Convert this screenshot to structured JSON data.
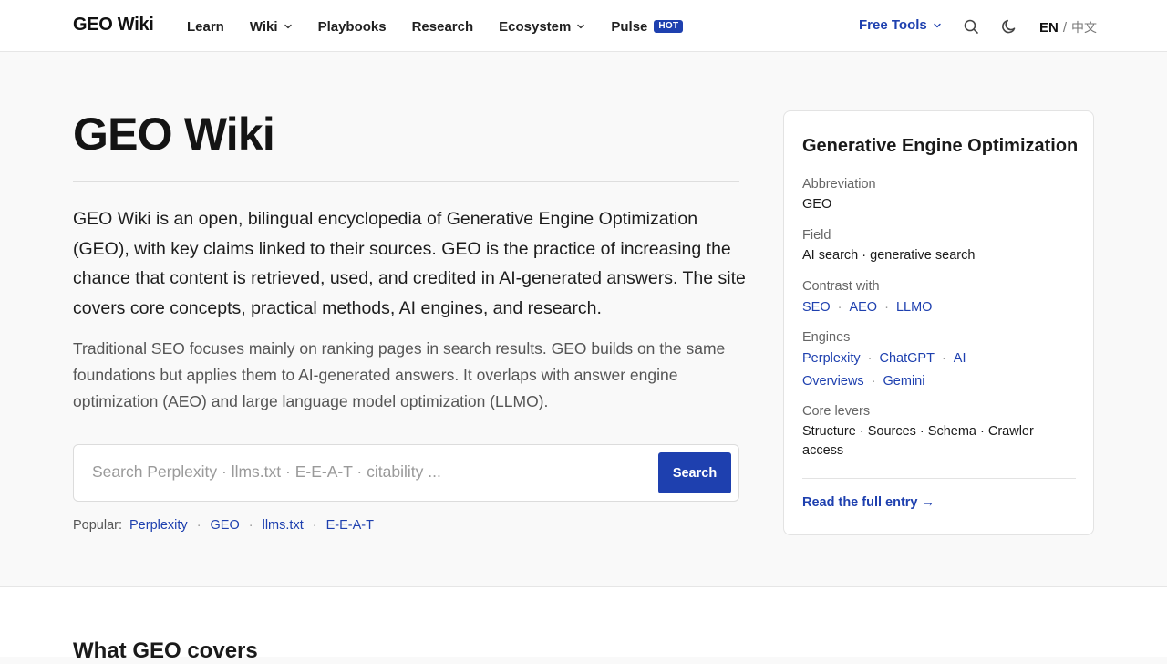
{
  "header": {
    "brand": "GEO Wiki",
    "nav": [
      {
        "label": "Learn"
      },
      {
        "label": "Wiki"
      },
      {
        "label": "Playbooks"
      },
      {
        "label": "Research"
      },
      {
        "label": "Ecosystem"
      },
      {
        "label": "Pulse",
        "badge": "HOT"
      }
    ],
    "free_tools": "Free Tools",
    "lang_en": "EN",
    "lang_sep": "/",
    "lang_zh": "中文"
  },
  "main": {
    "title": "GEO Wiki",
    "lead": "GEO Wiki is an open, bilingual encyclopedia of Generative Engine Optimization (GEO), with key claims linked to their sources. GEO is the practice of increasing the chance that content is retrieved, used, and credited in AI-generated answers. The site covers core concepts, practical methods, AI engines, and research.",
    "sub": "Traditional SEO focuses mainly on ranking pages in search results. GEO builds on the same foundations but applies them to AI-generated answers. It overlaps with answer engine optimization (AEO) and large language model optimization (LLMO).",
    "search": {
      "placeholder": "Search Perplexity · llms.txt · E-E-A-T · citability ...",
      "value": "",
      "button": "Search"
    },
    "popular": {
      "label": "Popular:",
      "items": [
        "Perplexity",
        "GEO",
        "llms.txt",
        "E-E-A-T"
      ]
    }
  },
  "card": {
    "title": "Generative Engine Optimization",
    "abbreviation_label": "Abbreviation",
    "abbreviation": "GEO",
    "field_label": "Field",
    "field": "AI search · generative search",
    "contrast_label": "Contrast with",
    "contrast": [
      "SEO",
      "AEO",
      "LLMO"
    ],
    "engines_label": "Engines",
    "engines": [
      "Perplexity",
      "ChatGPT",
      "AI Overviews",
      "Gemini"
    ],
    "levers_label": "Core levers",
    "levers": "Structure · Sources · Schema · Crawler access",
    "cta": "Read the full entry →"
  },
  "next_section": {
    "title": "What GEO covers"
  },
  "colors": {
    "accent": "#1e40af",
    "background": "#f9f9f9"
  }
}
